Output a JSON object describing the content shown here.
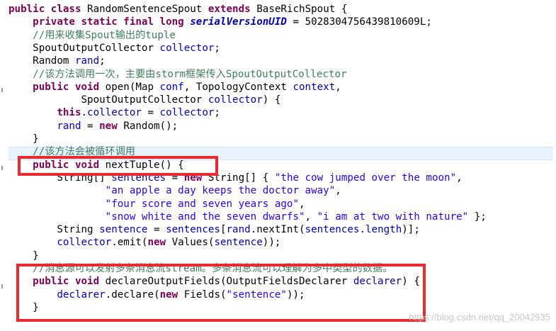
{
  "editor": {
    "language": "java",
    "lines": [
      [
        {
          "t": "public class ",
          "c": "kw"
        },
        {
          "t": "RandomSentenceSpout ",
          "c": ""
        },
        {
          "t": "extends ",
          "c": "kw"
        },
        {
          "t": "BaseRichSpout {",
          "c": ""
        }
      ],
      [
        {
          "t": "    private static final long ",
          "c": "kw"
        },
        {
          "t": "serialVersionUID",
          "c": "sfld"
        },
        {
          "t": " = 5028304756439810609L;",
          "c": ""
        }
      ],
      [
        {
          "t": "    //用来收集Spout输出的tuple",
          "c": "cm"
        }
      ],
      [
        {
          "t": "    SpoutOutputCollector ",
          "c": ""
        },
        {
          "t": "collector",
          "c": "fld"
        },
        {
          "t": ";",
          "c": ""
        }
      ],
      [
        {
          "t": "    Random ",
          "c": ""
        },
        {
          "t": "rand",
          "c": "fld"
        },
        {
          "t": ";",
          "c": ""
        }
      ],
      [
        {
          "t": "    //该方法调用一次，主要由storm框架传入SpoutOutputCollector",
          "c": "cm"
        }
      ],
      [
        {
          "t": "    public void ",
          "c": "kw"
        },
        {
          "t": "open(Map ",
          "c": ""
        },
        {
          "t": "conf",
          "c": "fld"
        },
        {
          "t": ", TopologyContext ",
          "c": ""
        },
        {
          "t": "context",
          "c": "fld"
        },
        {
          "t": ",",
          "c": ""
        }
      ],
      [
        {
          "t": "            SpoutOutputCollector ",
          "c": ""
        },
        {
          "t": "collector",
          "c": "fld"
        },
        {
          "t": ") {",
          "c": ""
        }
      ],
      [
        {
          "t": "        this",
          "c": "kw"
        },
        {
          "t": ".",
          "c": ""
        },
        {
          "t": "collector",
          "c": "fld"
        },
        {
          "t": " = ",
          "c": ""
        },
        {
          "t": "collector",
          "c": "fld"
        },
        {
          "t": ";",
          "c": ""
        }
      ],
      [
        {
          "t": "        ",
          "c": ""
        },
        {
          "t": "rand",
          "c": "fld"
        },
        {
          "t": " = ",
          "c": ""
        },
        {
          "t": "new ",
          "c": "kw"
        },
        {
          "t": "Random();",
          "c": ""
        }
      ],
      [
        {
          "t": "    }",
          "c": ""
        }
      ],
      [
        {
          "t": "    //该方法会被循环调用",
          "c": "cm"
        }
      ],
      [
        {
          "t": "    public void ",
          "c": "kw"
        },
        {
          "t": "nextTuple() {",
          "c": ""
        }
      ],
      [
        {
          "t": "        String[] ",
          "c": ""
        },
        {
          "t": "sentences",
          "c": "fld"
        },
        {
          "t": " = ",
          "c": ""
        },
        {
          "t": "new ",
          "c": "kw"
        },
        {
          "t": "String[] { ",
          "c": ""
        },
        {
          "t": "\"the cow jumped over the moon\"",
          "c": "str"
        },
        {
          "t": ",",
          "c": ""
        }
      ],
      [
        {
          "t": "                ",
          "c": ""
        },
        {
          "t": "\"an apple a day keeps the doctor away\"",
          "c": "str"
        },
        {
          "t": ",",
          "c": ""
        }
      ],
      [
        {
          "t": "                ",
          "c": ""
        },
        {
          "t": "\"four score and seven years ago\"",
          "c": "str"
        },
        {
          "t": ",",
          "c": ""
        }
      ],
      [
        {
          "t": "                ",
          "c": ""
        },
        {
          "t": "\"snow white and the seven dwarfs\"",
          "c": "str"
        },
        {
          "t": ", ",
          "c": ""
        },
        {
          "t": "\"i am at two with nature\"",
          "c": "str"
        },
        {
          "t": " };",
          "c": ""
        }
      ],
      [
        {
          "t": "        String ",
          "c": ""
        },
        {
          "t": "sentence",
          "c": "fld"
        },
        {
          "t": " = ",
          "c": ""
        },
        {
          "t": "sentences",
          "c": "fld"
        },
        {
          "t": "[",
          "c": ""
        },
        {
          "t": "rand",
          "c": "fld"
        },
        {
          "t": ".nextInt(",
          "c": ""
        },
        {
          "t": "sentences",
          "c": "fld"
        },
        {
          "t": ".",
          "c": ""
        },
        {
          "t": "length",
          "c": "fld"
        },
        {
          "t": ")];",
          "c": ""
        }
      ],
      [
        {
          "t": "        ",
          "c": ""
        },
        {
          "t": "collector",
          "c": "fld"
        },
        {
          "t": ".emit(",
          "c": ""
        },
        {
          "t": "new ",
          "c": "kw"
        },
        {
          "t": "Values(",
          "c": ""
        },
        {
          "t": "sentence",
          "c": "fld"
        },
        {
          "t": "));",
          "c": ""
        }
      ],
      [
        {
          "t": "    }",
          "c": ""
        }
      ],
      [
        {
          "t": "    //消息源可以发射多条消息流stream。多条消息流可以理解为多中类型的数据。",
          "c": "cm"
        }
      ],
      [
        {
          "t": "    public void ",
          "c": "kw"
        },
        {
          "t": "declareOutputFields(OutputFieldsDeclarer ",
          "c": ""
        },
        {
          "t": "declarer",
          "c": "fld"
        },
        {
          "t": ") {",
          "c": ""
        }
      ],
      [
        {
          "t": "        ",
          "c": ""
        },
        {
          "t": "declarer",
          "c": "fld"
        },
        {
          "t": ".declare(",
          "c": ""
        },
        {
          "t": "new ",
          "c": "kw"
        },
        {
          "t": "Fields(",
          "c": ""
        },
        {
          "t": "\"sentence\"",
          "c": "str"
        },
        {
          "t": "));",
          "c": ""
        }
      ],
      [
        {
          "t": "    }",
          "c": ""
        }
      ]
    ]
  },
  "annotations": {
    "color": "#e8292d"
  },
  "watermark": {
    "text": "https://blog.csdn.net/qq_20042935"
  }
}
